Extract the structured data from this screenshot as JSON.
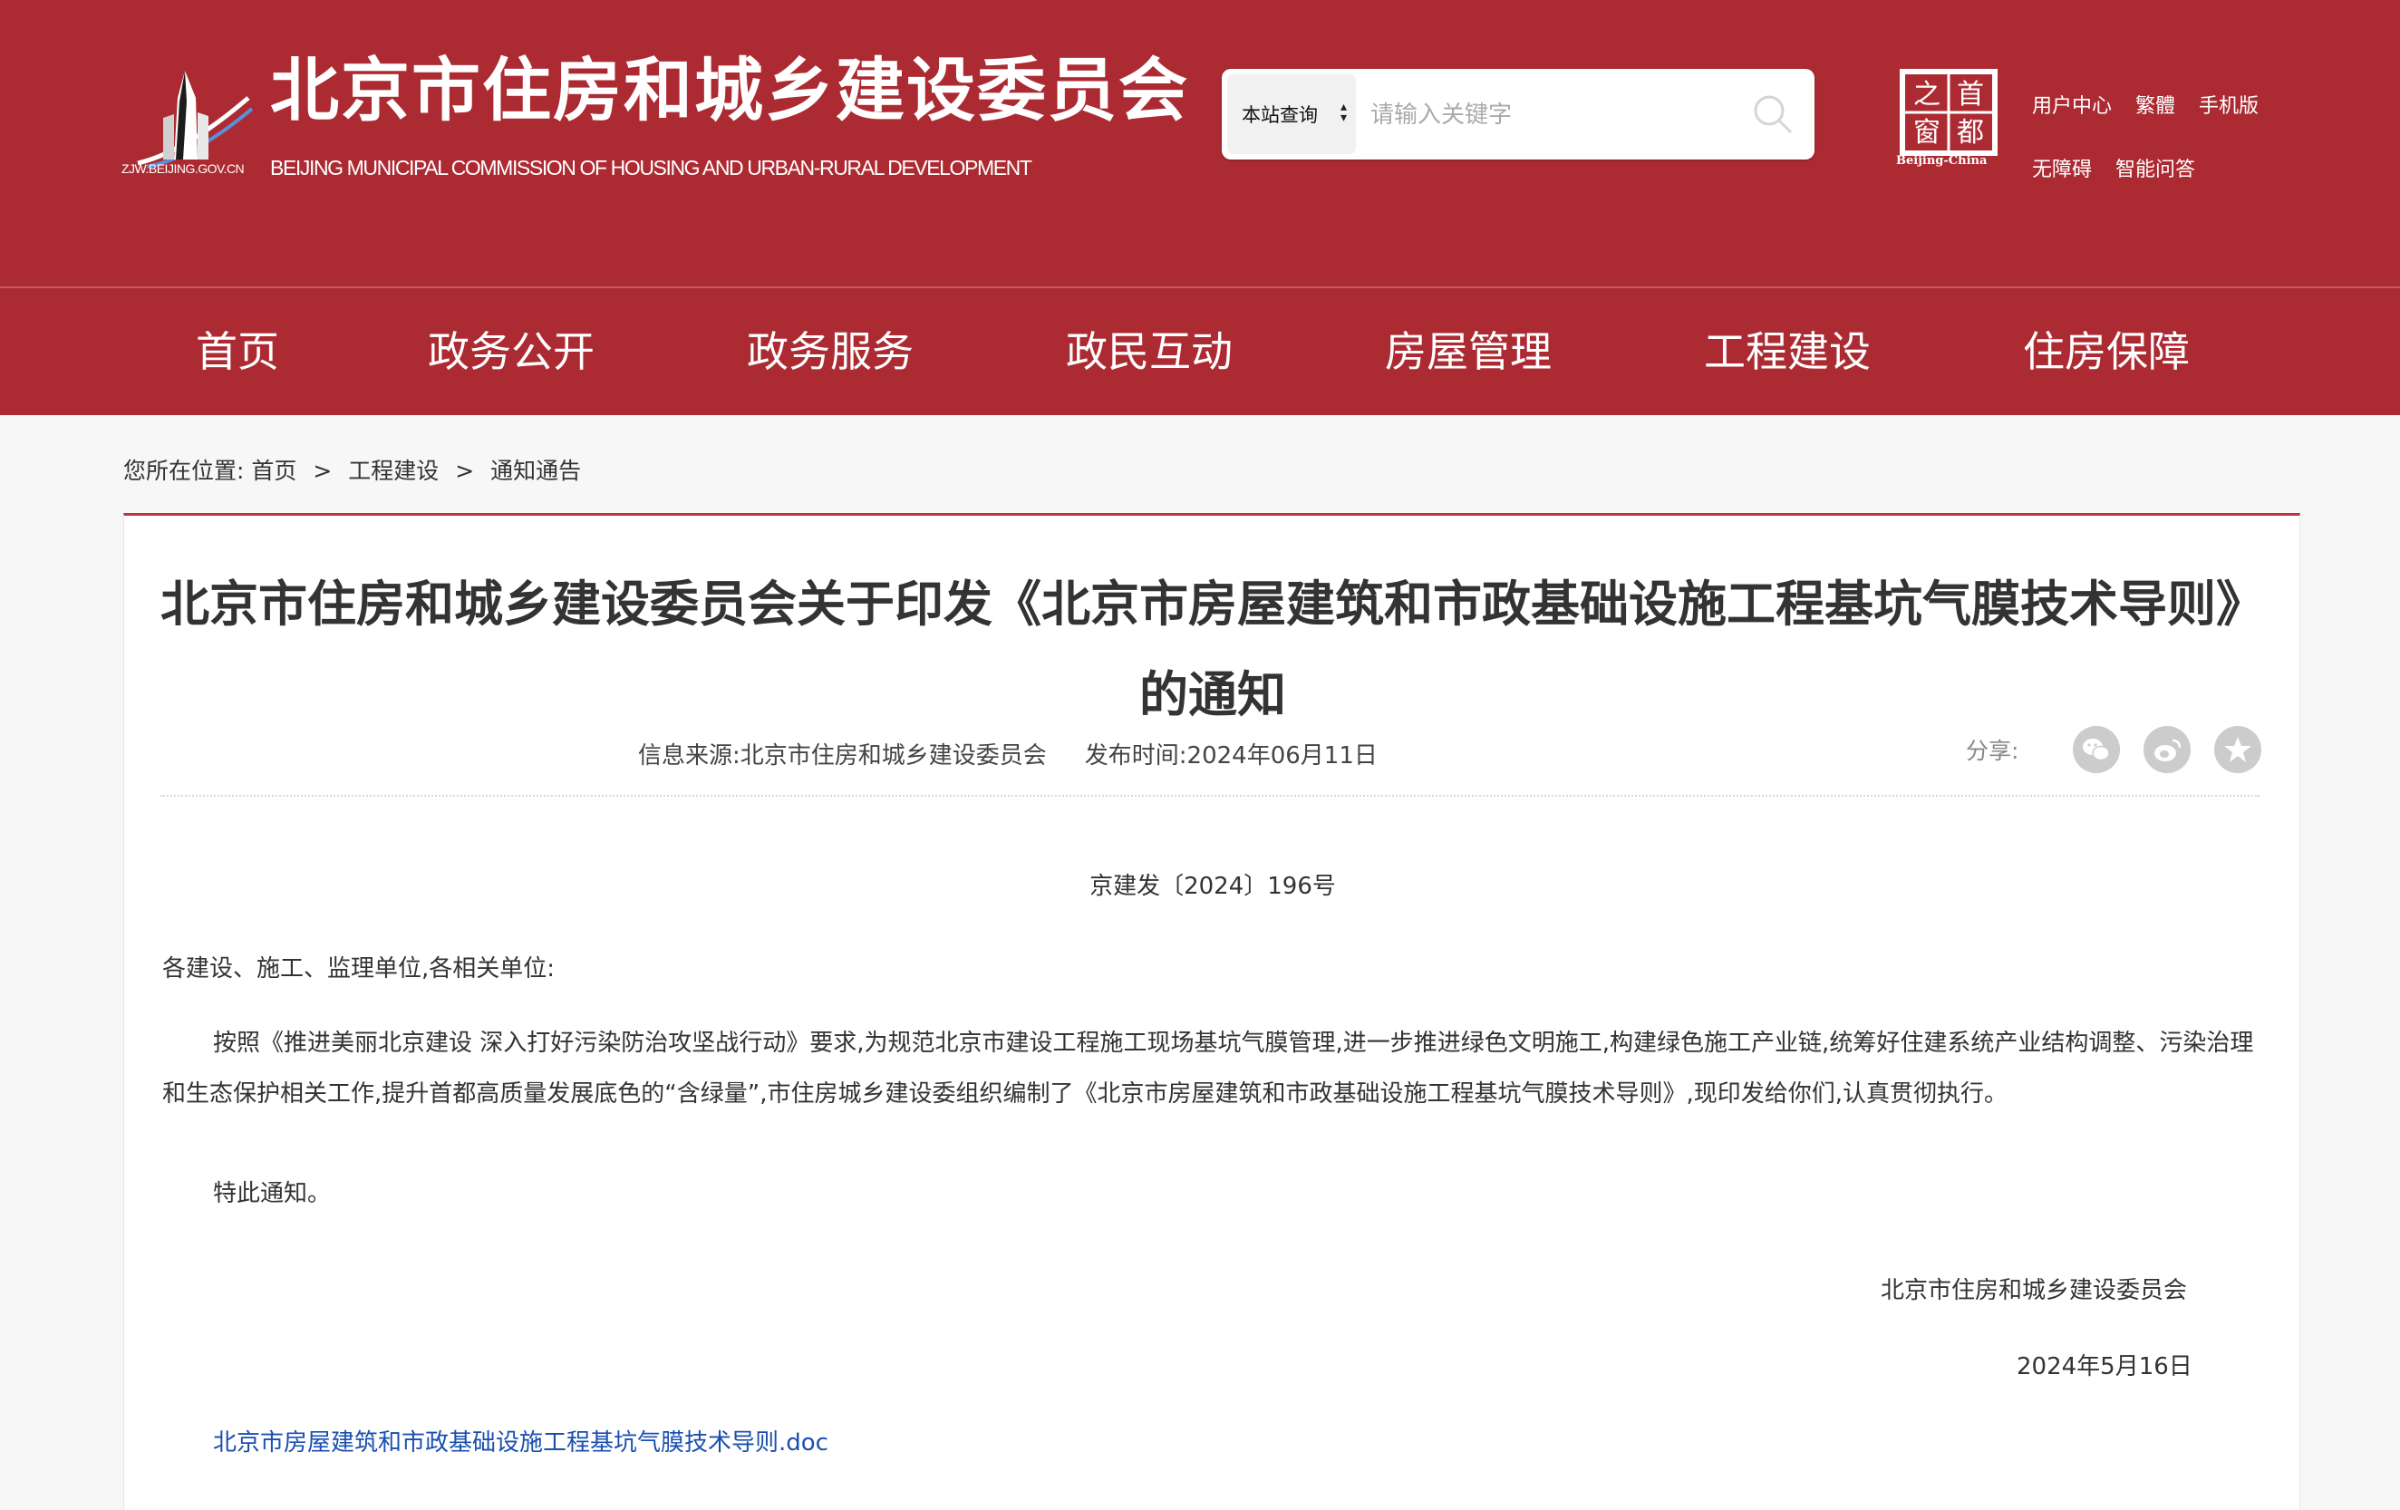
{
  "header": {
    "site_title": "北京市住房和城乡建设委员会",
    "site_subtitle": "BEIJING MUNICIPAL COMMISSION OF HOUSING AND URBAN-RURAL DEVELOPMENT",
    "logo_site": "ZJW.BEIJING.GOV.CN",
    "emblem_chars": [
      "之",
      "首",
      "窗",
      "都"
    ],
    "emblem_caption": "Beijing-China",
    "search": {
      "scope_label": "本站查询",
      "placeholder": "请输入关键字"
    },
    "links": [
      "用户中心",
      "繁體",
      "手机版",
      "无障碍",
      "智能问答"
    ]
  },
  "nav": [
    "首页",
    "政务公开",
    "政务服务",
    "政民互动",
    "房屋管理",
    "工程建设",
    "住房保障"
  ],
  "breadcrumb": {
    "prefix": "您所在位置:",
    "items": [
      "首页",
      "工程建设",
      "通知通告"
    ],
    "separator": ">"
  },
  "article": {
    "title": "北京市住房和城乡建设委员会关于印发《北京市房屋建筑和市政基础设施工程基坑气膜技术导则》的通知",
    "source": "信息来源:北京市住房和城乡建设委员会",
    "publish_time": "发布时间:2024年06月11日",
    "share_label": "分享:",
    "share_icons": [
      "wechat-icon",
      "weibo-icon",
      "favorite-icon"
    ],
    "doc_number": "京建发〔2024〕196号",
    "salutation": "各建设、施工、监理单位,各相关单位:",
    "paragraph": "按照《推进美丽北京建设 深入打好污染防治攻坚战行动》要求,为规范北京市建设工程施工现场基坑气膜管理,进一步推进绿色文明施工,构建绿色施工产业链,统筹好住建系统产业结构调整、污染治理和生态保护相关工作,提升首都高质量发展底色的“含绿量”,市住房城乡建设委组织编制了《北京市房屋建筑和市政基础设施工程基坑气膜技术导则》,现印发给你们,认真贯彻执行。",
    "closing": "特此通知。",
    "signature": "北京市住房和城乡建设委员会",
    "date": "2024年5月16日",
    "attachment": "北京市房屋建筑和市政基础设施工程基坑气膜技术导则.doc"
  },
  "colors": {
    "brand_red": "#ac2b33",
    "link_blue": "#1a4fb0"
  }
}
